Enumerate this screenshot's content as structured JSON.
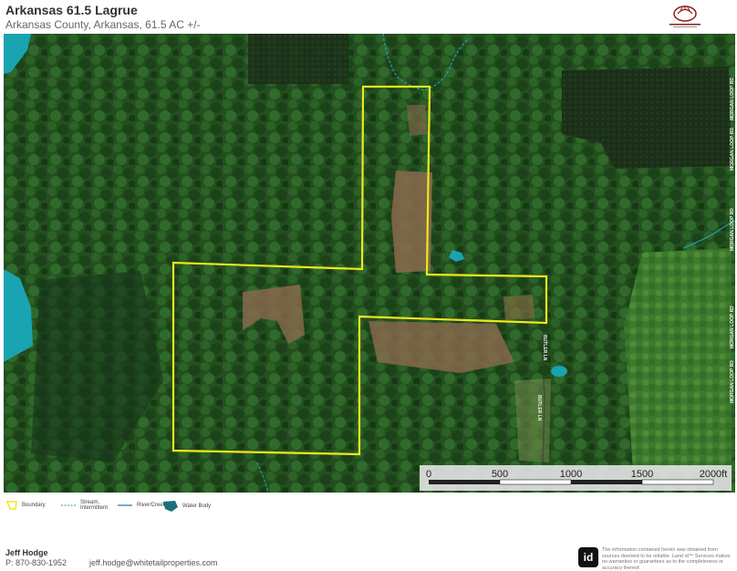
{
  "header": {
    "title": "Arkansas 61.5 Lagrue",
    "subtitle": "Arkansas County, Arkansas, 61.5 AC +/-"
  },
  "map": {
    "roads": [
      "MORGAN LOOP RD",
      "BUTLER LN"
    ],
    "boundary_color": "#f3e51f",
    "water_color": "#1aa3b0",
    "scale": {
      "labels": [
        "0",
        "500",
        "1000",
        "1500",
        "2000ft"
      ]
    }
  },
  "legend": {
    "items": [
      {
        "label": "Boundary",
        "icon": "boundary-icon"
      },
      {
        "label": "Stream, Intermittent",
        "icon": "stream-icon"
      },
      {
        "label": "River/Creek",
        "icon": "river-icon"
      },
      {
        "label": "Water Body",
        "icon": "water-body-icon"
      }
    ]
  },
  "footer": {
    "agent_name": "Jeff Hodge",
    "phone": "P: 870-830-1952",
    "email": "jeff.hodge@whitetailproperties.com",
    "badge": "id",
    "disclaimer": "The information contained herein was obtained from sources deemed to be reliable. Land id™ Services makes no warranties or guarantees as to the completeness or accuracy thereof."
  }
}
